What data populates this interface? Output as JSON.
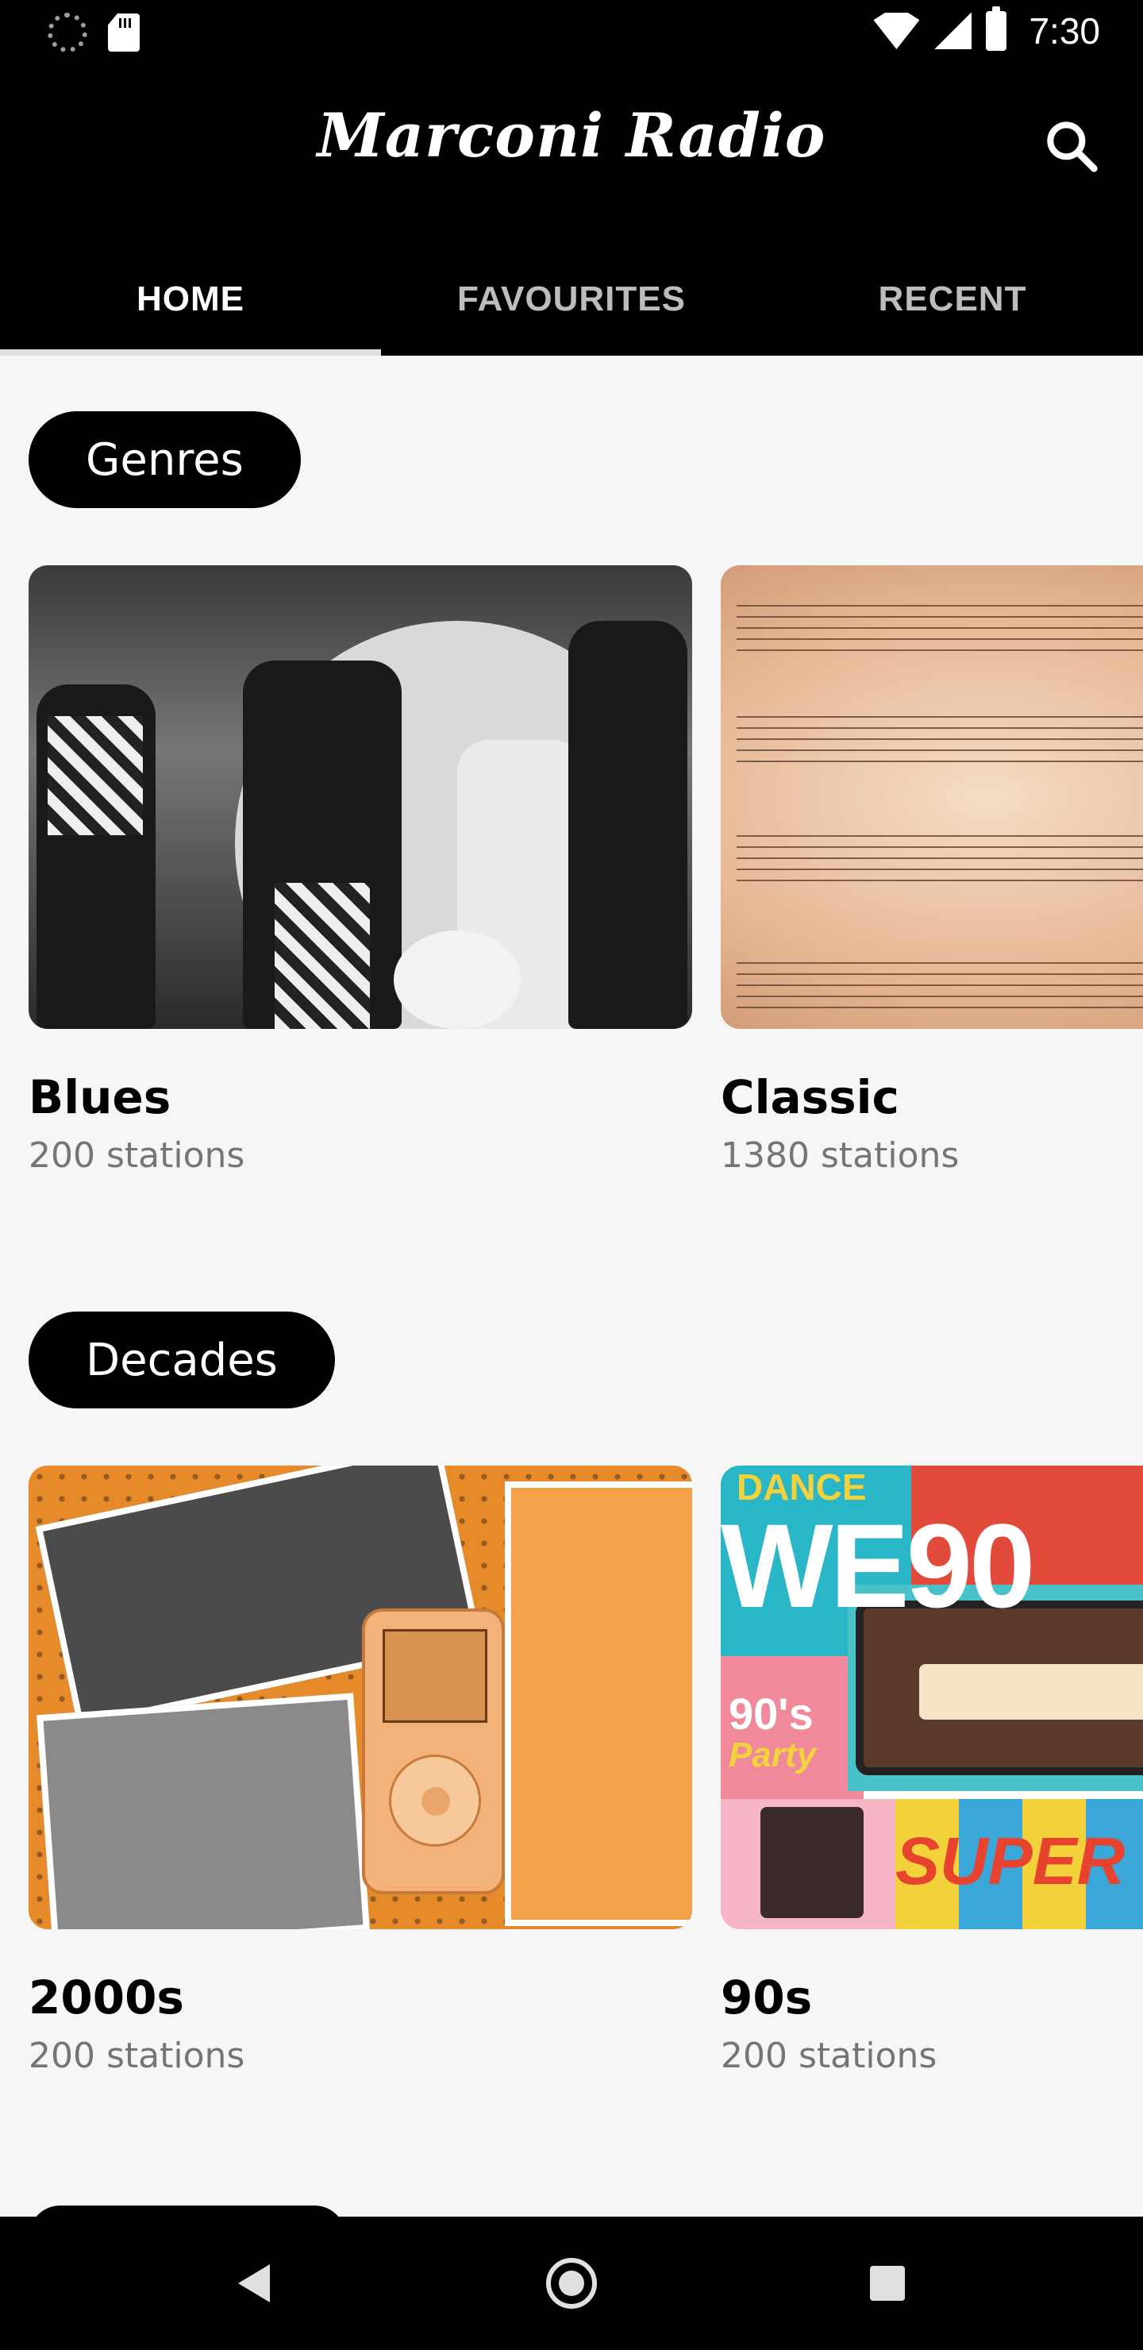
{
  "status_bar": {
    "time": "7:30",
    "icons": [
      "loading-spinner-icon",
      "sd-card-icon",
      "wifi-icon",
      "cell-signal-icon",
      "battery-icon"
    ]
  },
  "app_bar": {
    "title": "Marconi Radio",
    "search_icon": "search-icon"
  },
  "tabs": [
    {
      "label": "HOME",
      "active": true
    },
    {
      "label": "FAVOURITES",
      "active": false
    },
    {
      "label": "RECENT",
      "active": false
    }
  ],
  "sections": [
    {
      "label": "Genres",
      "cards": [
        {
          "title": "Blues",
          "subtitle": "200 stations"
        },
        {
          "title": "Classic",
          "subtitle": "1380 stations"
        }
      ]
    },
    {
      "label": "Decades",
      "cards": [
        {
          "title": "2000s",
          "subtitle": "200 stations"
        },
        {
          "title": "90s",
          "subtitle": "200 stations"
        }
      ]
    }
  ],
  "artwork_text": {
    "dance": "DANCE",
    "we90": "WE90",
    "nineties": "90's",
    "party": "Party",
    "super": "SUPER"
  },
  "nav_bar": {
    "icons": [
      "back-icon",
      "home-icon",
      "recent-apps-icon"
    ]
  },
  "colors": {
    "bar_background": "#000000",
    "content_background": "#f6f6f6",
    "pill_background": "#000000",
    "subtitle": "#757575",
    "inactive_tab": "#bdbdbd"
  }
}
